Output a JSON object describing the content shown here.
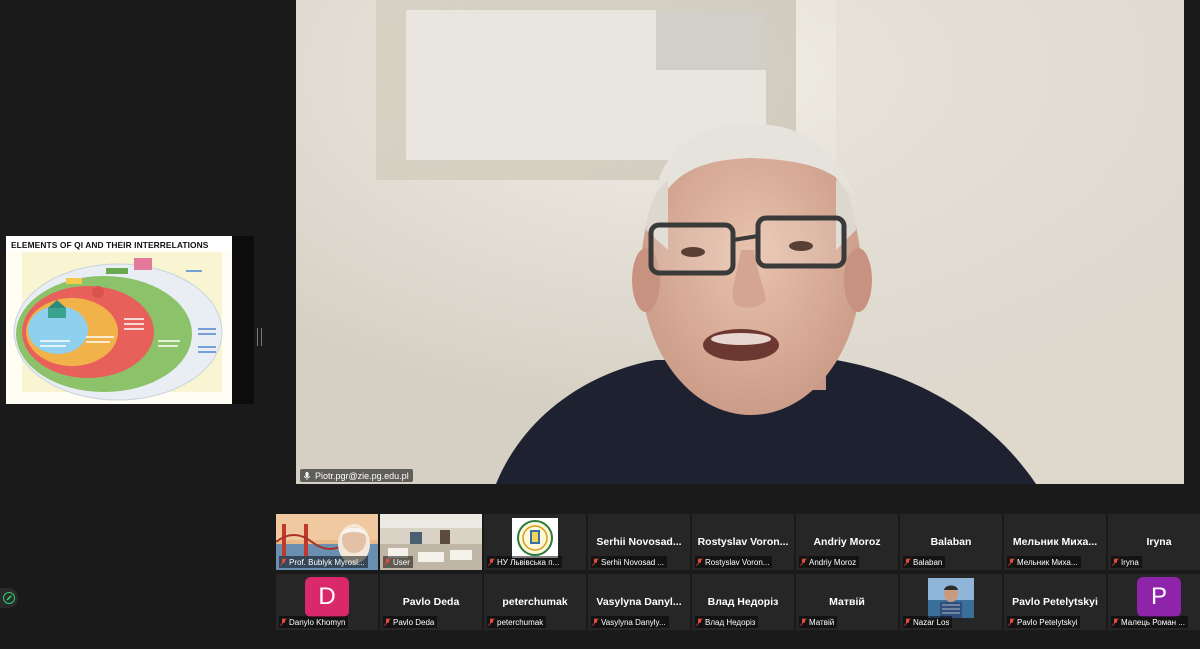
{
  "screen_share": {
    "slide_title": "ELEMENTS OF QI AND THEIR INTERRELATIONS"
  },
  "main_video": {
    "speaker_label": "Piotr.pgr@zie.pg.edu.pl"
  },
  "gallery": {
    "row1": [
      {
        "label": "Prof. Bublyk Myrosl...",
        "kind": "photo-bridge"
      },
      {
        "label": "User",
        "kind": "photo-room"
      },
      {
        "label": "НУ Львівська п...",
        "kind": "logo"
      },
      {
        "name": "Serhii  Novosad...",
        "label": "Serhii Novosad ...",
        "kind": "name"
      },
      {
        "name": "Rostyslav Voron...",
        "label": "Rostyslav Voron...",
        "kind": "name"
      },
      {
        "name": "Andriy Moroz",
        "label": "Andriy Moroz",
        "kind": "name"
      },
      {
        "name": "Balaban",
        "label": "Balaban",
        "kind": "name"
      },
      {
        "name": "Мельник  Миха...",
        "label": "Мельник Миха...",
        "kind": "name"
      },
      {
        "name": "Iryna",
        "label": "Iryna",
        "kind": "name"
      }
    ],
    "row2": [
      {
        "avatar": "D",
        "label": "Danylo Khomyn",
        "kind": "avatar",
        "color": "#d9296a"
      },
      {
        "name": "Pavlo Deda",
        "label": "Pavlo Deda",
        "kind": "name"
      },
      {
        "name": "peterchumak",
        "label": "peterchumak",
        "kind": "name"
      },
      {
        "name": "Vasylyna  Danyl...",
        "label": "Vasylyna Danyly...",
        "kind": "name"
      },
      {
        "name": "Влад Недоріз",
        "label": "Влад Недоріз",
        "kind": "name"
      },
      {
        "name": "Матвій",
        "label": "Матвій",
        "kind": "name"
      },
      {
        "label": "Nazar Los",
        "kind": "photo-person"
      },
      {
        "name": "Pavlo Petelytskyi",
        "label": "Pavlo Petelytskyi",
        "kind": "name"
      },
      {
        "avatar": "P",
        "label": "Малець Роман ...",
        "kind": "avatar",
        "color": "#8e24aa"
      }
    ]
  }
}
